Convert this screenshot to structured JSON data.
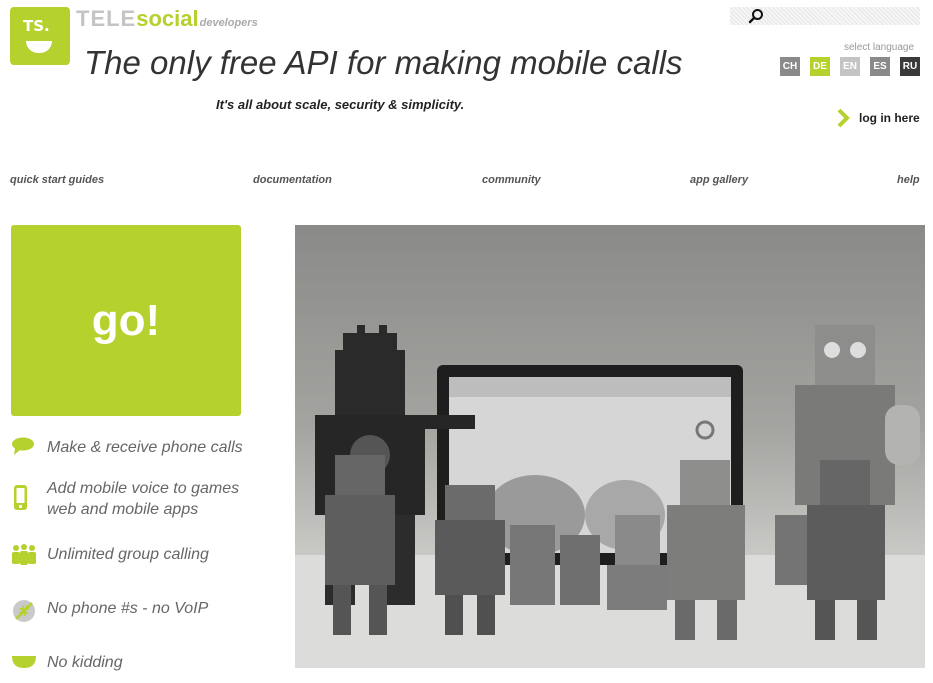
{
  "logo": {
    "initials": "TS."
  },
  "brand": {
    "tele": "TELE",
    "social": "social",
    "developers": "developers"
  },
  "headline": "The only free API for making mobile calls",
  "tagline": "It's all about scale, security & simplicity.",
  "search": {
    "placeholder": ""
  },
  "language": {
    "label": "select language",
    "options": [
      {
        "code": "CH",
        "color": "#8a8a8a"
      },
      {
        "code": "DE",
        "color": "#b5d12d"
      },
      {
        "code": "EN",
        "color": "#c4c4c4"
      },
      {
        "code": "ES",
        "color": "#8a8a8a"
      },
      {
        "code": "RU",
        "color": "#3a3a3a"
      }
    ]
  },
  "login": {
    "label": "log in here"
  },
  "nav": {
    "quick_start": "quick start guides",
    "documentation": "documentation",
    "community": "community",
    "app_gallery": "app gallery",
    "help": "help"
  },
  "go": {
    "label": "go!"
  },
  "features": [
    {
      "icon": "speech-bubble-icon",
      "lines": [
        "Make & receive phone calls"
      ]
    },
    {
      "icon": "mobile-phone-icon",
      "lines": [
        "Add mobile voice to games",
        "web and mobile apps"
      ]
    },
    {
      "icon": "group-icon",
      "lines": [
        "Unlimited group calling"
      ]
    },
    {
      "icon": "no-phone-icon",
      "lines": [
        "No phone #s - no VoIP"
      ]
    },
    {
      "icon": "smile-icon",
      "lines": [
        "No kidding"
      ]
    }
  ],
  "colors": {
    "accent": "#b5d12d"
  }
}
